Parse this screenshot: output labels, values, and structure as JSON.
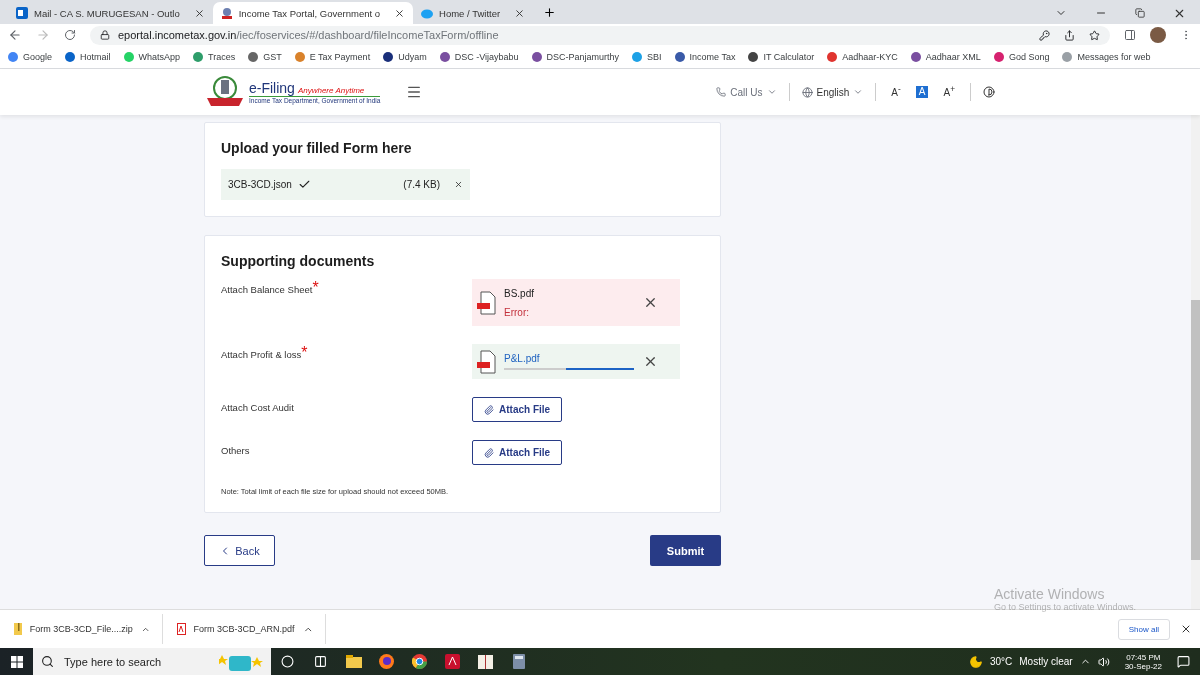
{
  "browser": {
    "tabs": [
      {
        "title": "Mail - CA S. MURUGESAN - Outlo",
        "kind": "mail",
        "selected": false
      },
      {
        "title": "Income Tax Portal, Government o",
        "kind": "emblem",
        "selected": true
      },
      {
        "title": "Home / Twitter",
        "kind": "bird",
        "selected": false
      }
    ],
    "address": {
      "host": "eportal.incometax.gov.in",
      "path": "/iec/foservices/#/dashboard/fileIncomeTaxForm/offline"
    },
    "bookmarks": [
      {
        "label": "Google",
        "color": "#4285f4"
      },
      {
        "label": "Hotmail",
        "color": "#0a64c8"
      },
      {
        "label": "WhatsApp",
        "color": "#25d366"
      },
      {
        "label": "Traces",
        "color": "#2e9d6a"
      },
      {
        "label": "GST",
        "color": "#666666"
      },
      {
        "label": "E Tax Payment",
        "color": "#d9822b"
      },
      {
        "label": "Udyam",
        "color": "#1a2f7a"
      },
      {
        "label": "DSC -Vijaybabu",
        "color": "#7a4fa0"
      },
      {
        "label": "DSC-Panjamurthy",
        "color": "#7a4fa0"
      },
      {
        "label": "SBI",
        "color": "#1da1e6"
      },
      {
        "label": "Income Tax",
        "color": "#3a5aa8"
      },
      {
        "label": "IT Calculator",
        "color": "#444444"
      },
      {
        "label": "Aadhaar-KYC",
        "color": "#e0342f"
      },
      {
        "label": "Aadhaar XML",
        "color": "#7a4fa0"
      },
      {
        "label": "God Song",
        "color": "#d6226f"
      },
      {
        "label": "Messages for web",
        "color": "#9aa0a6"
      }
    ]
  },
  "header": {
    "brand": "e-Filing",
    "tagline": "Anywhere Anytime",
    "subtitle": "Income Tax Department, Government of India",
    "call_us": "Call Us",
    "language": "English",
    "font_sizes": [
      {
        "label": "A$^{-}$",
        "selected": false
      },
      {
        "label": "A",
        "selected": true
      },
      {
        "label": "A$^{+}$",
        "selected": false
      }
    ]
  },
  "upload": {
    "title": "Upload your filled Form here",
    "file": {
      "name": "3CB-3CD.json",
      "size": "(7.4 KB)",
      "verified": true
    }
  },
  "supporting": {
    "title": "Supporting documents",
    "rows": [
      {
        "kind": "error",
        "label": "Attach Balance Sheet",
        "required_mark": "*",
        "file": "BS.pdf",
        "message": "Error:"
      },
      {
        "kind": "progress",
        "label": "Attach Profit & loss",
        "required_mark": "*",
        "file": "P&L.pdf",
        "level": 0.52
      },
      {
        "kind": "attach",
        "label": "Attach Cost Audit",
        "button": "Attach File"
      },
      {
        "kind": "attach",
        "label": "Others",
        "button": "Attach File"
      }
    ],
    "note": "Note: Total limit of each file size for upload should not exceed 50MB."
  },
  "actions": {
    "back": "Back",
    "submit": "Submit"
  },
  "watermark": {
    "title": "Activate Windows",
    "subtitle": "Go to Settings to activate Windows."
  },
  "downloads": {
    "items": [
      {
        "name": "Form 3CB-3CD_File....zip",
        "kind": "zip"
      },
      {
        "name": "Form 3CB-3CD_ARN.pdf",
        "kind": "pdf"
      }
    ],
    "show_all": "Show all"
  },
  "taskbar": {
    "search_placeholder": "Type here to search",
    "temperature": "30°C",
    "weather": "Mostly clear",
    "time": "07:45 PM",
    "date": "30-Sep-22"
  }
}
